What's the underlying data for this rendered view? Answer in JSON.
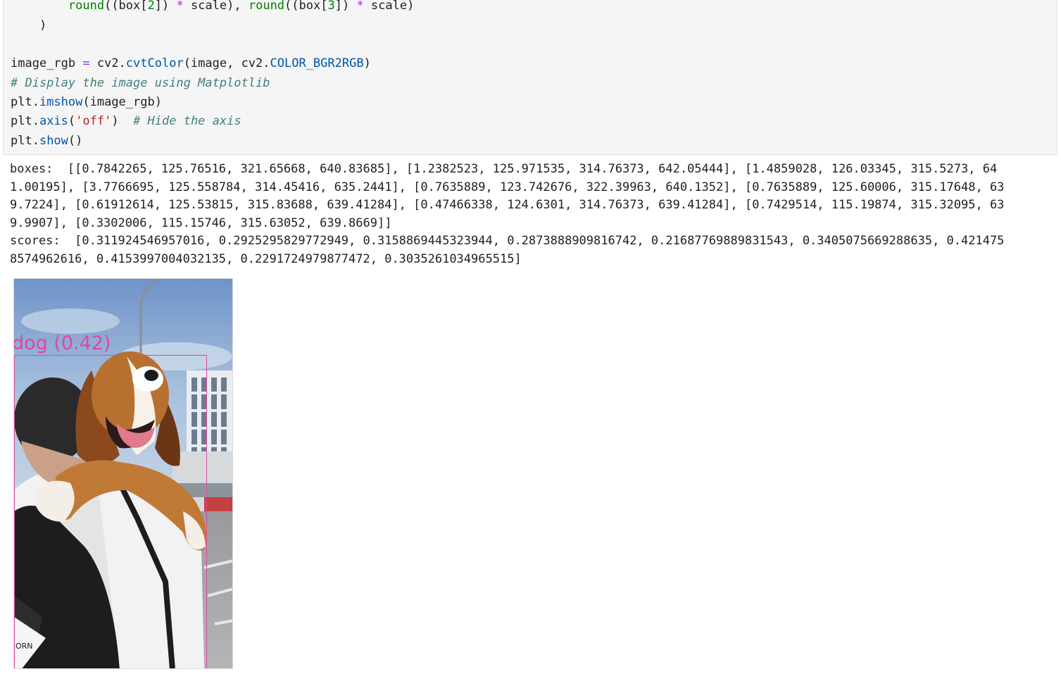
{
  "code_cell": {
    "lines": [
      {
        "indent": "        ",
        "parts": [
          {
            "t": "round",
            "c": "kw-fn"
          },
          {
            "t": "((box",
            "c": ""
          },
          {
            "t": "[",
            "c": ""
          },
          {
            "t": "2",
            "c": "num"
          },
          {
            "t": "]) ",
            "c": ""
          },
          {
            "t": "*",
            "c": "op"
          },
          {
            "t": " scale), ",
            "c": ""
          },
          {
            "t": "round",
            "c": "kw-fn"
          },
          {
            "t": "((box[",
            "c": ""
          },
          {
            "t": "3",
            "c": "num"
          },
          {
            "t": "]) ",
            "c": ""
          },
          {
            "t": "*",
            "c": "op"
          },
          {
            "t": " scale)",
            "c": ""
          }
        ]
      },
      {
        "indent": "    ",
        "parts": [
          {
            "t": ")",
            "c": ""
          }
        ]
      },
      {
        "indent": "",
        "parts": []
      },
      {
        "indent": "",
        "parts": [
          {
            "t": "image_rgb ",
            "c": ""
          },
          {
            "t": "=",
            "c": "op"
          },
          {
            "t": " cv2.",
            "c": ""
          },
          {
            "t": "cvtColor",
            "c": "attr"
          },
          {
            "t": "(image, cv2.",
            "c": ""
          },
          {
            "t": "COLOR_BGR2RGB",
            "c": "const"
          },
          {
            "t": ")",
            "c": ""
          }
        ]
      },
      {
        "indent": "",
        "parts": [
          {
            "t": "# Display the image using Matplotlib",
            "c": "cmt"
          }
        ]
      },
      {
        "indent": "",
        "parts": [
          {
            "t": "plt.",
            "c": ""
          },
          {
            "t": "imshow",
            "c": "attr"
          },
          {
            "t": "(image_rgb)",
            "c": ""
          }
        ]
      },
      {
        "indent": "",
        "parts": [
          {
            "t": "plt.",
            "c": ""
          },
          {
            "t": "axis",
            "c": "attr"
          },
          {
            "t": "(",
            "c": ""
          },
          {
            "t": "'off'",
            "c": "str"
          },
          {
            "t": ")  ",
            "c": ""
          },
          {
            "t": "# Hide the axis",
            "c": "cmt"
          }
        ]
      },
      {
        "indent": "",
        "parts": [
          {
            "t": "plt.",
            "c": ""
          },
          {
            "t": "show",
            "c": "attr"
          },
          {
            "t": "()",
            "c": ""
          }
        ]
      }
    ]
  },
  "output": {
    "lines": [
      "boxes:  [[0.7842265, 125.76516, 321.65668, 640.83685], [1.2382523, 125.971535, 314.76373, 642.05444], [1.4859028, 126.03345, 315.5273, 64",
      "1.00195], [3.7766695, 125.558784, 314.45416, 635.2441], [0.7635889, 123.742676, 322.39963, 640.1352], [0.7635889, 125.60006, 315.17648, 63",
      "9.7224], [0.61912614, 125.53815, 315.83688, 639.41284], [0.47466338, 124.6301, 314.76373, 639.41284], [0.7429514, 115.19874, 315.32095, 63",
      "9.9907], [0.3302006, 115.15746, 315.63052, 639.8669]]",
      "scores:  [0.311924546957016, 0.2925295829772949, 0.3158869445323944, 0.2873888909816742, 0.21687769889831543, 0.3405075669288635, 0.421475",
      "8574962616, 0.4153997004032135, 0.2291724979877472, 0.3035261034965515]"
    ]
  },
  "figure": {
    "label": "dog (0.42)",
    "box_color": "#e0479e",
    "corner_text": "ORN"
  }
}
